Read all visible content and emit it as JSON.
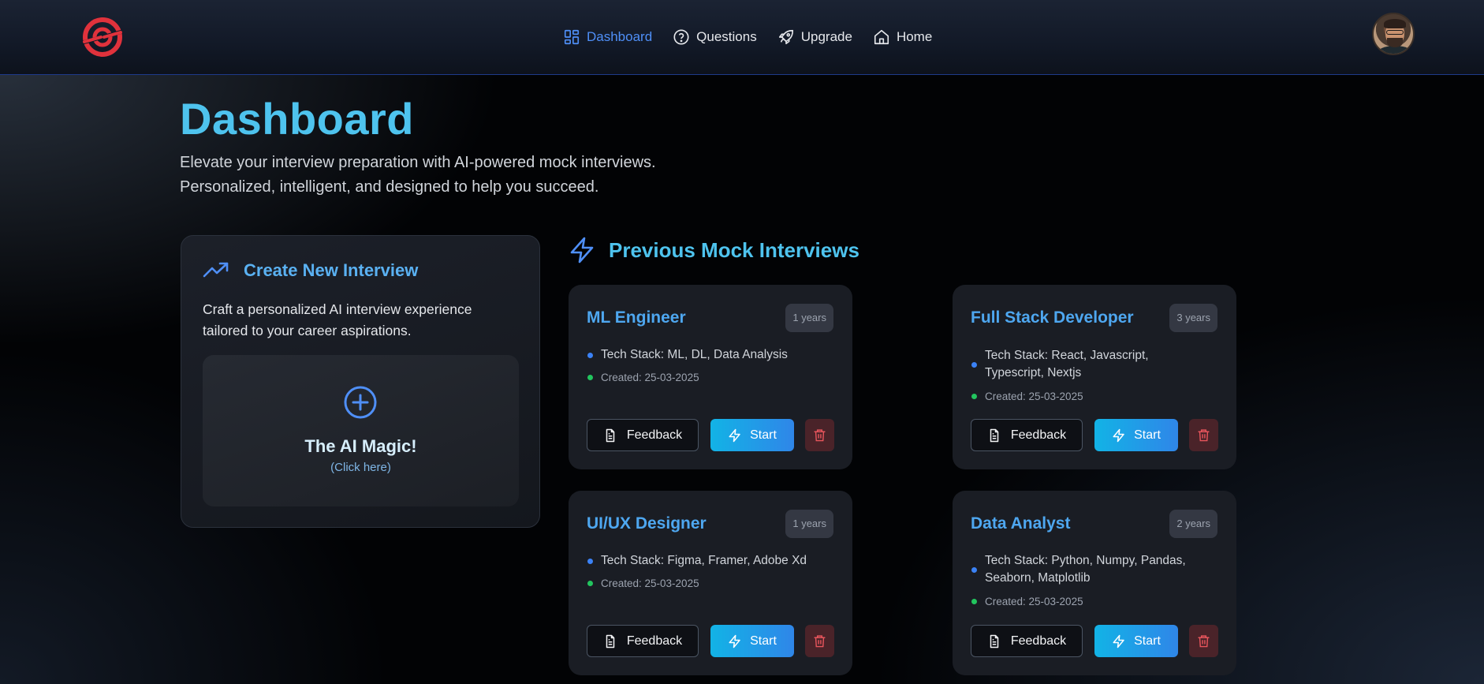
{
  "nav": {
    "items": [
      {
        "label": "Dashboard",
        "icon": "dashboard-grid-icon",
        "active": true
      },
      {
        "label": "Questions",
        "icon": "question-circle-icon",
        "active": false
      },
      {
        "label": "Upgrade",
        "icon": "rocket-icon",
        "active": false
      },
      {
        "label": "Home",
        "icon": "home-icon",
        "active": false
      }
    ]
  },
  "hero": {
    "title": "Dashboard",
    "subtitle_line1": "Elevate your interview preparation with AI-powered mock interviews.",
    "subtitle_line2": "Personalized, intelligent, and designed to help you succeed."
  },
  "create": {
    "title": "Create New Interview",
    "description": "Craft a personalized AI interview experience tailored to your career aspirations.",
    "magic_title": "The AI Magic!",
    "magic_sub": "(Click here)"
  },
  "previous": {
    "heading": "Previous Mock Interviews",
    "interviews": [
      {
        "title": "ML Engineer",
        "experience": "1 years",
        "tech": "Tech Stack: ML, DL, Data Analysis",
        "created": "Created: 25-03-2025",
        "feedback_label": "Feedback",
        "start_label": "Start"
      },
      {
        "title": "Full Stack Developer",
        "experience": "3 years",
        "tech": "Tech Stack: React, Javascript, Typescript, Nextjs",
        "created": "Created: 25-03-2025",
        "feedback_label": "Feedback",
        "start_label": "Start"
      },
      {
        "title": "UI/UX Designer",
        "experience": "1 years",
        "tech": "Tech Stack: Figma, Framer, Adobe Xd",
        "created": "Created: 25-03-2025",
        "feedback_label": "Feedback",
        "start_label": "Start"
      },
      {
        "title": "Data Analyst",
        "experience": "2 years",
        "tech": "Tech Stack: Python, Numpy, Pandas, Seaborn, Matplotlib",
        "created": "Created: 25-03-2025",
        "feedback_label": "Feedback",
        "start_label": "Start"
      }
    ]
  },
  "colors": {
    "accent_cyan": "#4ec3ee",
    "accent_blue": "#4ea7f0",
    "nav_active": "#4f8ff7",
    "logo_red": "#e0323c",
    "start_gradient": [
      "#12b3e6",
      "#2f86e8"
    ],
    "delete_bg": "#4a2329"
  }
}
